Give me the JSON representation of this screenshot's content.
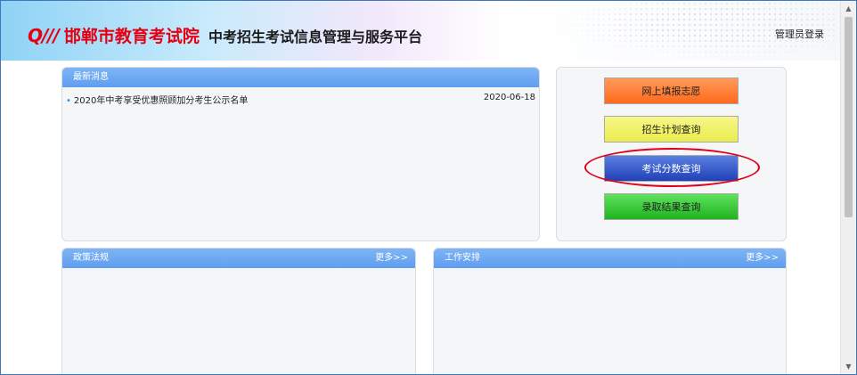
{
  "header": {
    "logo_mark": "Q///",
    "org_name": "邯郸市教育考试院",
    "platform_title": "中考招生考试信息管理与服务平台",
    "admin_login": "管理员登录"
  },
  "latest_news": {
    "title": "最新消息",
    "items": [
      {
        "title": "2020年中考享受优惠照顾加分考生公示名单",
        "date": "2020-06-18"
      }
    ]
  },
  "quick_buttons": {
    "fill_volunteer": "网上填报志愿",
    "plan_query": "招生计划查询",
    "score_query": "考试分数查询",
    "admission_query": "录取结果查询"
  },
  "policy": {
    "title": "政策法规",
    "more": "更多>>"
  },
  "work": {
    "title": "工作安排",
    "more": "更多>>"
  },
  "colors": {
    "accent_red": "#e60012",
    "panel_head": "#6aa6f3"
  },
  "annotation": {
    "highlighted": "score_query"
  }
}
